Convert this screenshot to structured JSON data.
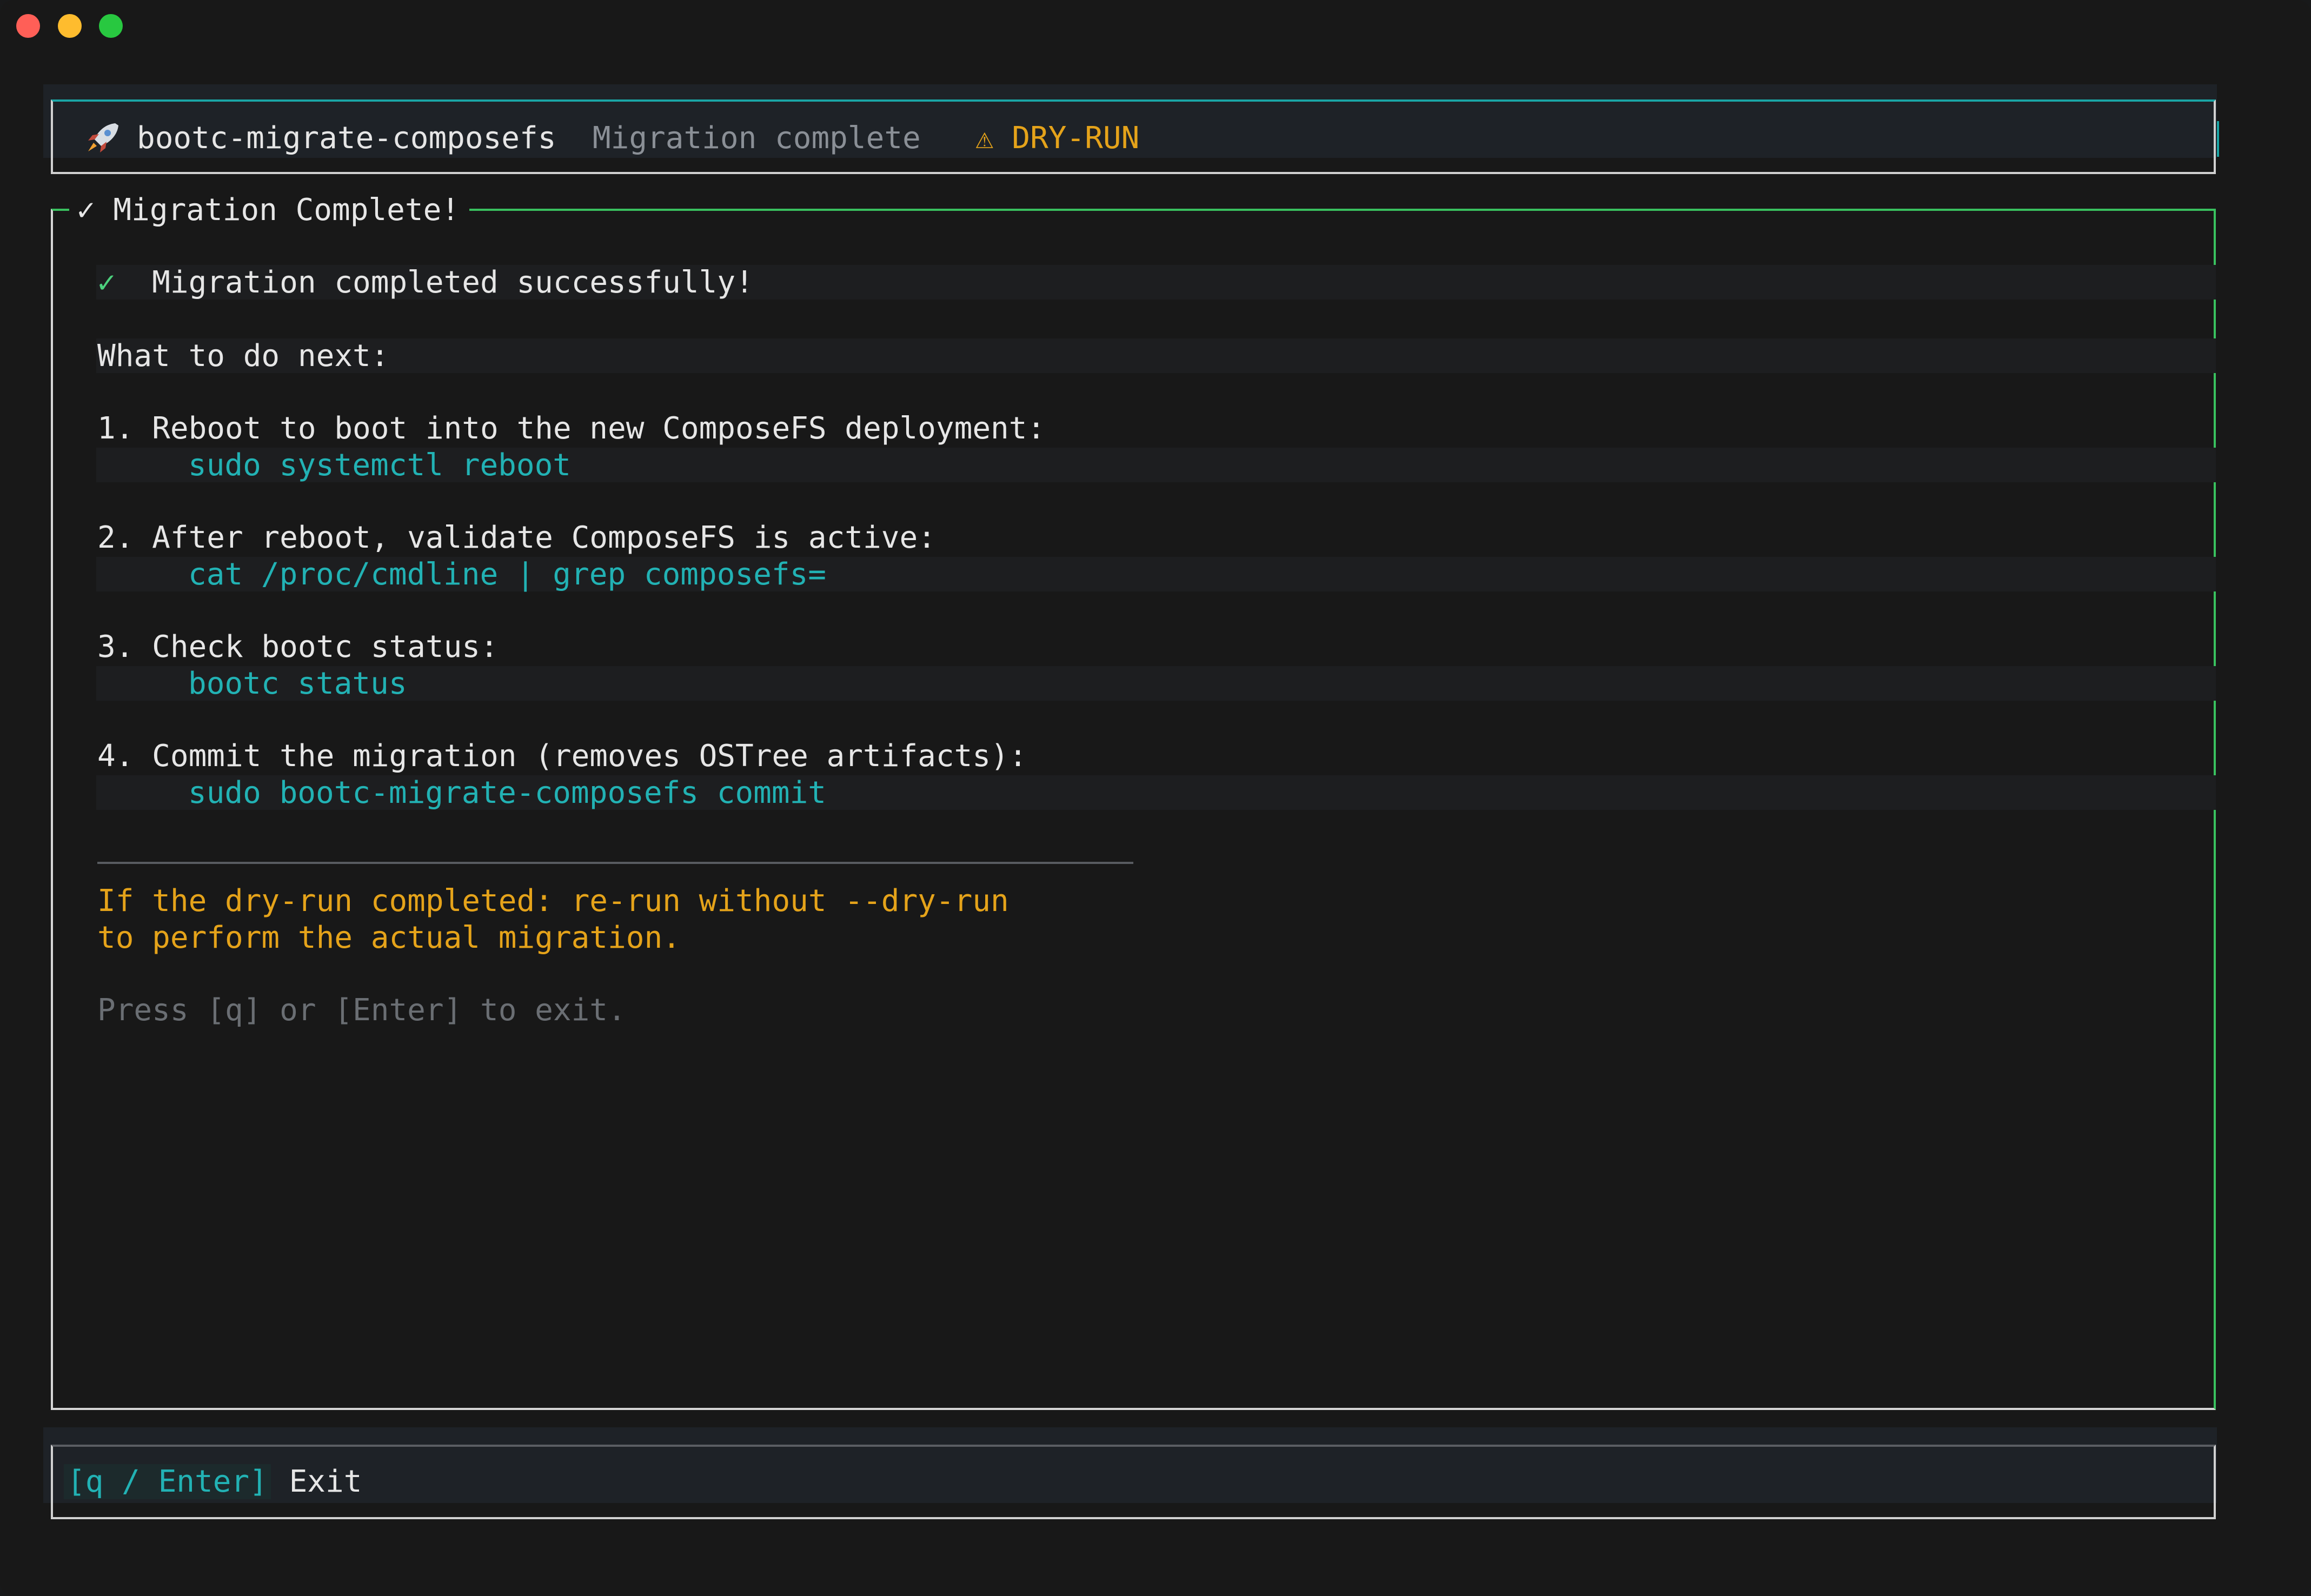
{
  "header": {
    "app_name": "bootc-migrate-composefs",
    "status": "Migration complete",
    "warning": "⚠ DRY-RUN"
  },
  "panel": {
    "title": "✓ Migration Complete!",
    "success_icon": "✓",
    "success_text": "Migration completed successfully!",
    "next_heading": "What to do next:",
    "steps": [
      {
        "text": "1. Reboot to boot into the new ComposeFS deployment:",
        "command": "sudo systemctl reboot"
      },
      {
        "text": "2. After reboot, validate ComposeFS is active:",
        "command": "cat /proc/cmdline | grep composefs="
      },
      {
        "text": "3. Check bootc status:",
        "command": "bootc status"
      },
      {
        "text": "4. Commit the migration (removes OSTree artifacts):",
        "command": "sudo bootc-migrate-composefs commit"
      }
    ],
    "dry_run_note_1": "If the dry-run completed: re-run without --dry-run",
    "dry_run_note_2": "to perform the actual migration.",
    "exit_hint": "Press [q] or [Enter] to exit."
  },
  "footer": {
    "key": "[q / Enter]",
    "action": "Exit"
  },
  "colors": {
    "accent_cyan": "#22b2b4",
    "success_green": "#39c15f",
    "warning_amber": "#e5a31a",
    "background": "#181818"
  },
  "icons": [
    "rocket-icon",
    "check-icon",
    "warning-icon"
  ]
}
